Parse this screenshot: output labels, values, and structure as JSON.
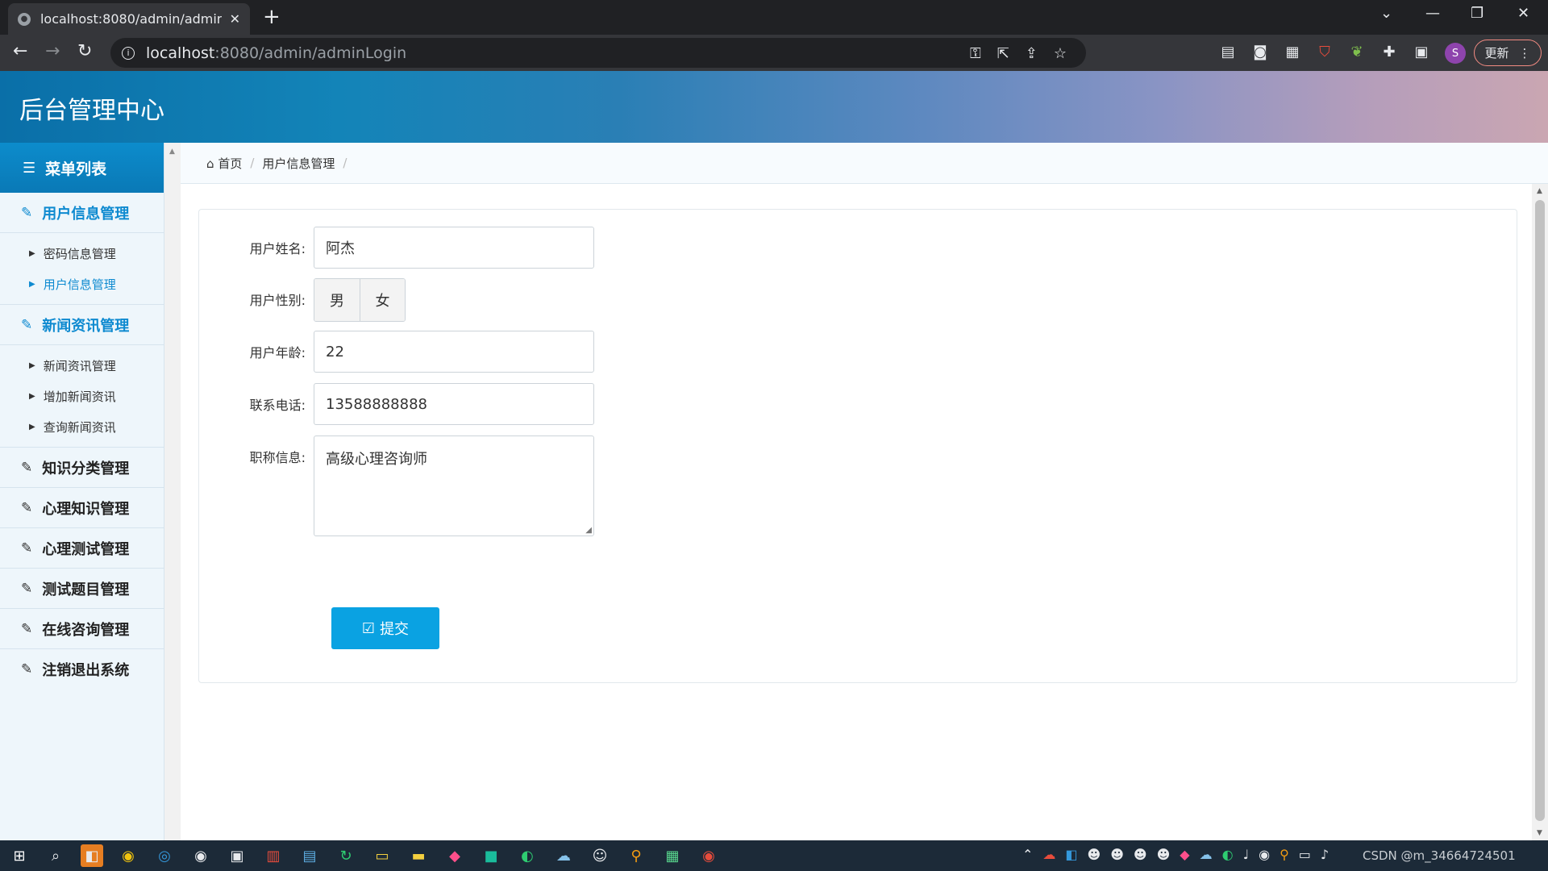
{
  "browser": {
    "tab_title": "localhost:8080/admin/adminL",
    "new_tab": "+",
    "url_host": "localhost",
    "url_rest": ":8080/admin/adminLogin",
    "update_label": "更新",
    "profile_initial": "S"
  },
  "app": {
    "title": "后台管理中心"
  },
  "sidebar": {
    "header": "菜单列表",
    "groups": [
      {
        "label": "用户信息管理",
        "items": [
          "密码信息管理",
          "用户信息管理"
        ]
      },
      {
        "label": "新闻资讯管理",
        "items": [
          "新闻资讯管理",
          "增加新闻资讯",
          "查询新闻资讯"
        ]
      },
      {
        "label": "知识分类管理"
      },
      {
        "label": "心理知识管理"
      },
      {
        "label": "心理测试管理"
      },
      {
        "label": "测试题目管理"
      },
      {
        "label": "在线咨询管理"
      },
      {
        "label": "注销退出系统"
      }
    ]
  },
  "breadcrumb": {
    "home": "首页",
    "current": "用户信息管理"
  },
  "form": {
    "name_label": "用户姓名:",
    "name_value": "阿杰",
    "gender_label": "用户性别:",
    "gender_options": [
      "男",
      "女"
    ],
    "age_label": "用户年龄:",
    "age_value": "22",
    "phone_label": "联系电话:",
    "phone_value": "13588888888",
    "title_label": "职称信息:",
    "title_value": "高级心理咨询师",
    "submit_label": "提交"
  },
  "taskbar": {
    "tray_text": "CSDN @m_34664724501"
  }
}
